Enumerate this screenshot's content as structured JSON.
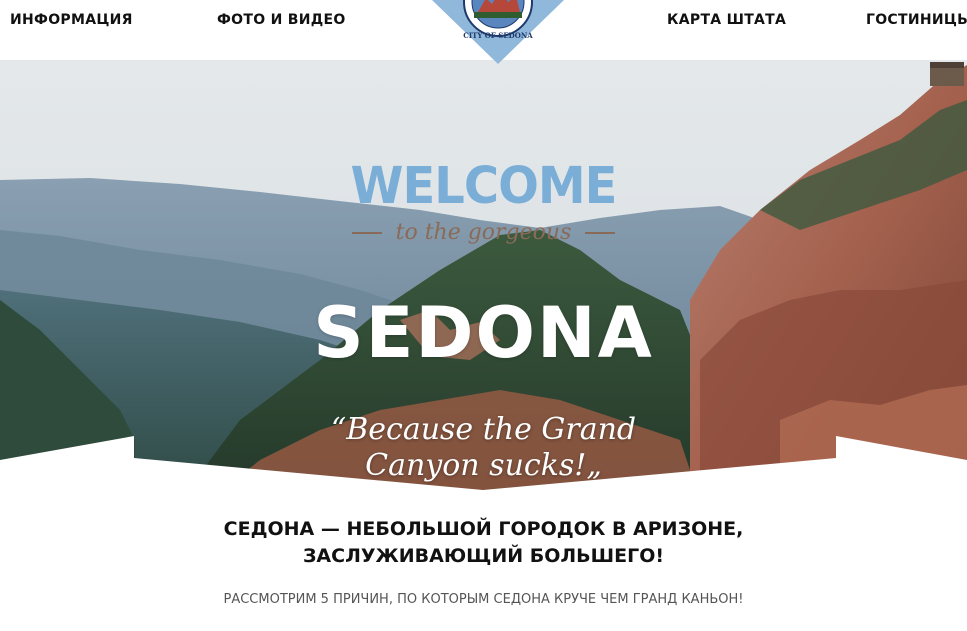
{
  "nav": {
    "items": [
      {
        "label": "ИНФОРМАЦИЯ"
      },
      {
        "label": "ФОТО И ВИДЕО"
      },
      {
        "label": "КАРТА ШТАТА"
      },
      {
        "label": "ГОСТИНИЦЫ"
      }
    ]
  },
  "logo": {
    "text": "CITY OF SEDONA"
  },
  "hero": {
    "welcome": "WELCOME",
    "tagline": "to the gorgeous",
    "title": "SEDONA",
    "quote_line1": "“Because the Grand",
    "quote_line2": "Canyon sucks!„"
  },
  "content": {
    "headline_line1": "СЕДОНА — НЕБОЛЬШОЙ ГОРОДОК В АРИЗОНЕ,",
    "headline_line2": "ЗАСЛУЖИВАЮЩИЙ БОЛЬШЕГО!",
    "subtext": "РАССМОТРИМ 5 ПРИЧИН, ПО КОТОРЫМ СЕДОНА КРУЧЕ ЧЕМ ГРАНД КАНЬОН!"
  },
  "colors": {
    "welcome": "#7aaed6",
    "tagline": "#8a6a58",
    "logo_blue": "#8fb8db",
    "background": "#ffffff"
  }
}
